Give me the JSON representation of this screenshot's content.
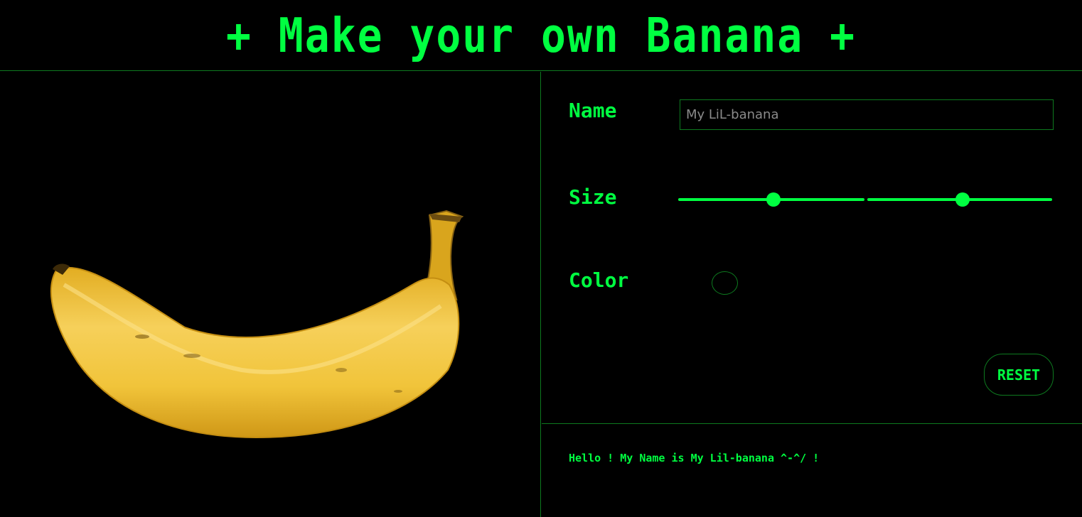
{
  "header": {
    "title": "+ Make your own Banana +"
  },
  "preview": {
    "image": "banana-image"
  },
  "form": {
    "name_label": "Name",
    "name_placeholder": "My LiL-banana",
    "size_label": "Size",
    "size_sliders": [
      {
        "value": 0.52
      },
      {
        "value": 0.51
      }
    ],
    "color_label": "Color",
    "color_value": "#000000",
    "reset_label": "RESET"
  },
  "greeting": {
    "text": "Hello ! My Name is My Lil-banana ^-^/ !"
  },
  "colors": {
    "accent": "#00ff41",
    "border": "#0d7a1f",
    "background": "#000000",
    "banana": "#f2c531"
  }
}
